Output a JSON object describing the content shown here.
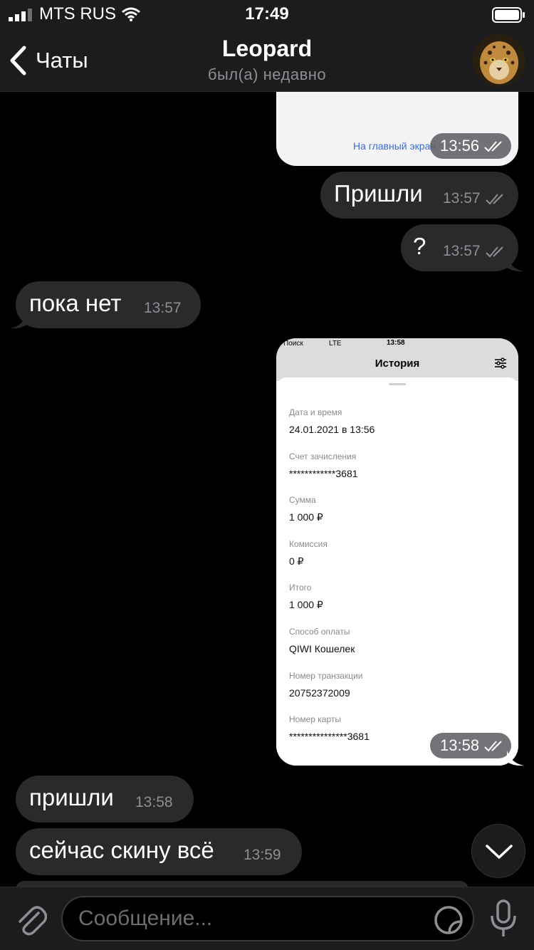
{
  "status_bar": {
    "carrier": "MTS RUS",
    "time": "17:49"
  },
  "header": {
    "back_label": "Чаты",
    "title": "Leopard",
    "subtitle": "был(а) недавно"
  },
  "messages": {
    "top_partial": {
      "link": "На главный экран",
      "time": "13:56"
    },
    "m1": {
      "text": "Пришли",
      "time": "13:57"
    },
    "m2": {
      "text": "?",
      "time": "13:57"
    },
    "m3": {
      "text": "пока нет",
      "time": "13:57"
    },
    "m5": {
      "text": "пришли",
      "time": "13:58"
    },
    "m6": {
      "text": "сейчас скину всё",
      "time": "13:59"
    }
  },
  "receipt": {
    "status_left": "Поиск",
    "status_network": "LTE",
    "status_time": "13:58",
    "title": "История",
    "time": "13:58",
    "fields": [
      {
        "label": "Дата и время",
        "value": "24.01.2021 в 13:56"
      },
      {
        "label": "Счет зачисления",
        "value": "************3681"
      },
      {
        "label": "Сумма",
        "value": "1 000 ₽"
      },
      {
        "label": "Комиссия",
        "value": "0 ₽"
      },
      {
        "label": "Итого",
        "value": "1 000 ₽"
      },
      {
        "label": "Способ оплаты",
        "value": "QIWI Кошелек"
      },
      {
        "label": "Номер транзакции",
        "value": "20752372009"
      },
      {
        "label": "Номер карты",
        "value": "***************3681"
      }
    ]
  },
  "input": {
    "placeholder": "Сообщение..."
  },
  "colors": {
    "bubble": "#2a2a2c",
    "bar": "#1c1c1e",
    "secondary_text": "#8e8e93",
    "link": "#3d6bd4"
  },
  "icons": [
    "signal-icon",
    "wifi-icon",
    "battery-icon",
    "back-chevron-icon",
    "read-checks-icon",
    "filter-icon",
    "attach-icon",
    "sticker-icon",
    "microphone-icon",
    "chevron-down-icon"
  ]
}
